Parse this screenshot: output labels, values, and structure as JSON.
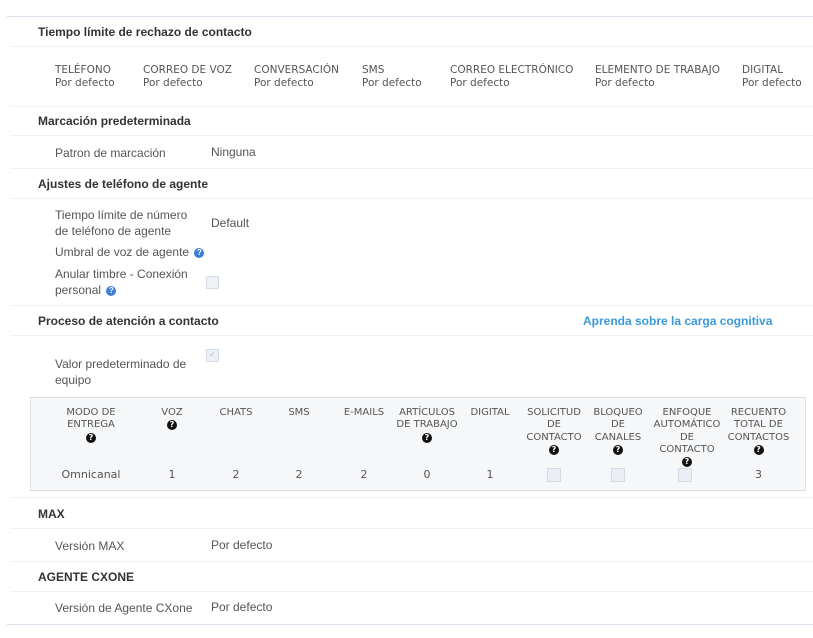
{
  "sections": {
    "rejection_timeout": {
      "title": "Tiempo límite de rechazo de contacto",
      "channels": [
        {
          "name": "TELÉFONO",
          "value": "Por defecto"
        },
        {
          "name": "CORREO DE VOZ",
          "value": "Por defecto"
        },
        {
          "name": "CONVERSACIÓN",
          "value": "Por defecto"
        },
        {
          "name": "SMS",
          "value": "Por defecto"
        },
        {
          "name": "CORREO ELECTRÓNICO",
          "value": "Por defecto"
        },
        {
          "name": "ELEMENTO DE TRABAJO",
          "value": "Por defecto"
        },
        {
          "name": "DIGITAL",
          "value": "Por defecto"
        }
      ]
    },
    "default_dialing": {
      "title": "Marcación predeterminada",
      "pattern_label": "Patron de marcación",
      "pattern_value": "Ninguna"
    },
    "agent_phone": {
      "title": "Ajustes de teléfono de agente",
      "timeout_label": "Tiempo límite de número de teléfono de agente",
      "timeout_value": "Default",
      "voice_threshold_label": "Umbral de voz de agente",
      "override_ring_label": "Anular timbre - Conexión personal",
      "override_ring_checked": false
    },
    "contact_handling": {
      "title": "Proceso de atención a contacto",
      "link": "Aprenda sobre la carga cognitiva",
      "team_default_label": "Valor predeterminado de equipo",
      "team_default_checked": true,
      "table": {
        "headers": [
          {
            "label": "MODO DE ENTREGA",
            "help": true
          },
          {
            "label": "VOZ",
            "help": true
          },
          {
            "label": "CHATS",
            "help": false
          },
          {
            "label": "SMS",
            "help": false
          },
          {
            "label": "E-MAILS",
            "help": false
          },
          {
            "label": "ARTÍCULOS DE TRABAJO",
            "help": true
          },
          {
            "label": "DIGITAL",
            "help": false
          },
          {
            "label": "SOLICITUD DE CONTACTO",
            "help": true
          },
          {
            "label": "BLOQUEO DE CANALES",
            "help": true
          },
          {
            "label": "ENFOQUE AUTOMÁTICO DE CONTACTO",
            "help": true
          },
          {
            "label": "RECUENTO TOTAL DE CONTACTOS",
            "help": true
          }
        ],
        "row": {
          "delivery_mode": "Omnicanal",
          "voice": "1",
          "chats": "2",
          "sms": "2",
          "emails": "2",
          "work_items": "0",
          "digital": "1",
          "contact_request": false,
          "channel_lock": false,
          "contact_autofocus": false,
          "total_contacts": "3"
        }
      }
    },
    "max": {
      "title": "MAX",
      "version_label": "Versión MAX",
      "version_value": "Por defecto"
    },
    "cxone_agent": {
      "title": "AGENTE CXONE",
      "version_label": "Versión de Agente CXone",
      "version_value": "Por defecto"
    }
  },
  "help_glyph": "?"
}
